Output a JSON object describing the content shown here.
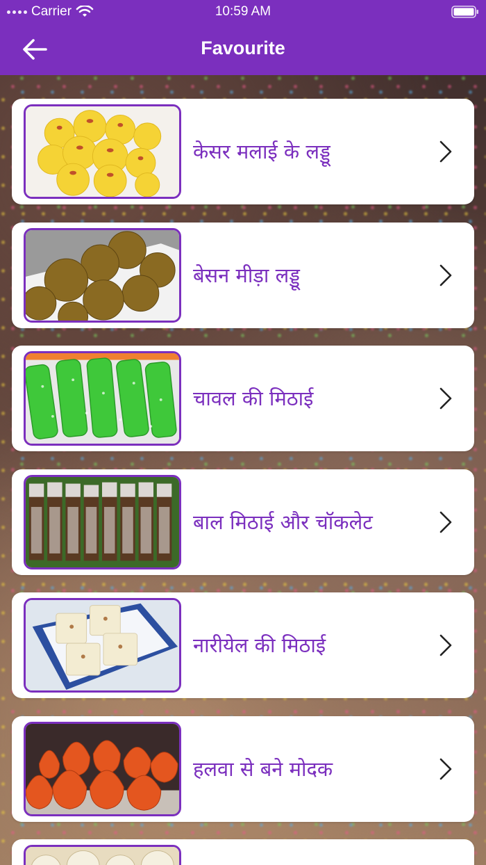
{
  "status_bar": {
    "carrier": "Carrier",
    "time": "10:59 AM",
    "icons": [
      "signal-icon",
      "wifi-icon",
      "battery-icon"
    ]
  },
  "nav": {
    "title": "Favourite",
    "back_icon": "arrow-left-icon"
  },
  "colors": {
    "primary": "#7b2fbe",
    "card_bg": "#ffffff",
    "text_accent": "#7b2fbe"
  },
  "items": [
    {
      "title": "केसर मलाई के लड्डू",
      "image": "kesar-laddu"
    },
    {
      "title": "बेसन मीड़ा लड्डू",
      "image": "besan-laddu"
    },
    {
      "title": "चावल की मिठाई",
      "image": "rice-sweet"
    },
    {
      "title": "बाल मिठाई और चॉकलेट",
      "image": "bal-mithai"
    },
    {
      "title": "नारीयेल की मिठाई",
      "image": "coconut-sweet"
    },
    {
      "title": "हलवा से बने मोदक",
      "image": "halwa-modak"
    }
  ]
}
